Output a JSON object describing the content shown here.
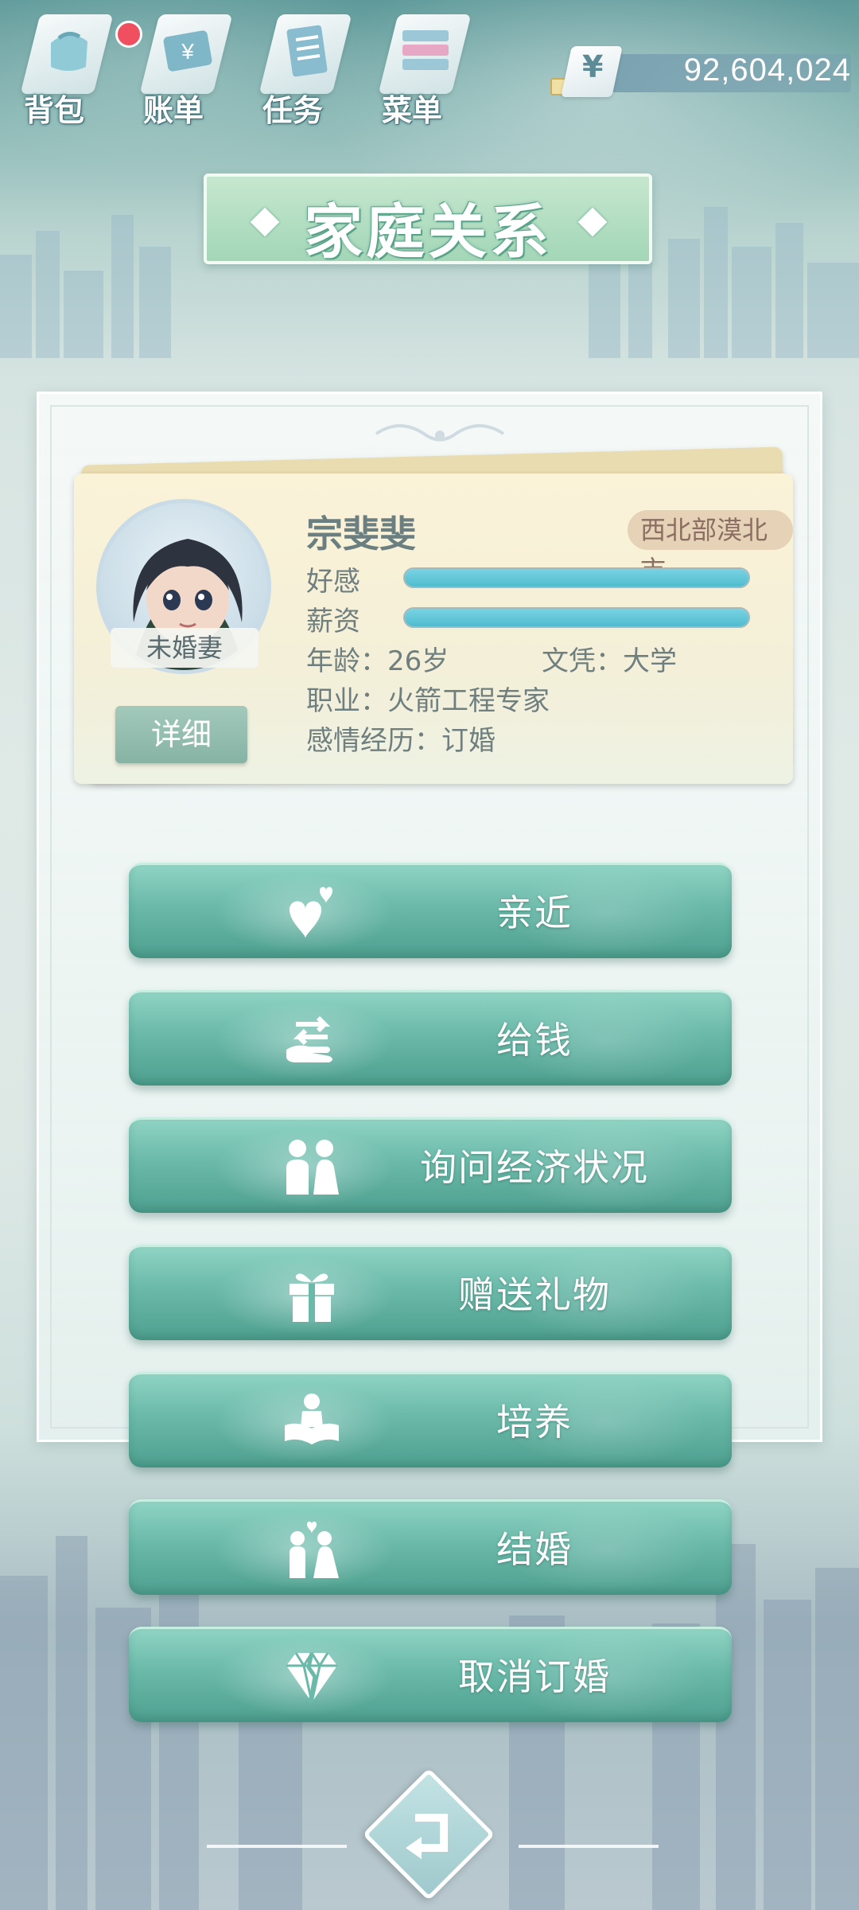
{
  "top_nav": [
    {
      "label": "背包",
      "icon": "backpack-icon",
      "has_badge": true
    },
    {
      "label": "账单",
      "icon": "bill-icon"
    },
    {
      "label": "任务",
      "icon": "task-icon"
    },
    {
      "label": "菜单",
      "icon": "menu-icon"
    }
  ],
  "currency": {
    "symbol": "¥",
    "amount": "92,604,024"
  },
  "title": "家庭关系",
  "character": {
    "name": "宗斐斐",
    "region": "西北部漠北市",
    "status_tag": "未婚妻",
    "detail_button": "详细",
    "stats": [
      {
        "label": "好感",
        "value_fraction": 1.0
      },
      {
        "label": "薪资",
        "value_fraction": 1.0
      }
    ],
    "age_text": "年龄：26岁",
    "education_text": "文凭：大学",
    "job_text": "职业：火箭工程专家",
    "relationship_text": "感情经历：订婚"
  },
  "actions": [
    {
      "label": "亲近",
      "icon": "hearts-icon"
    },
    {
      "label": "给钱",
      "icon": "give-money-icon"
    },
    {
      "label": "询问经济状况",
      "icon": "couple-talk-icon"
    },
    {
      "label": "赠送礼物",
      "icon": "gift-icon"
    },
    {
      "label": "培养",
      "icon": "reading-person-icon"
    },
    {
      "label": "结婚",
      "icon": "wedding-couple-icon"
    },
    {
      "label": "取消订婚",
      "icon": "broken-diamond-icon"
    }
  ],
  "colors": {
    "button_teal": "#6ab9a9",
    "title_green": "#a3d6b7",
    "stat_fill": "#4fbccf",
    "badge_red": "#ef4f5e",
    "card_bg": "#fbf3d8"
  }
}
